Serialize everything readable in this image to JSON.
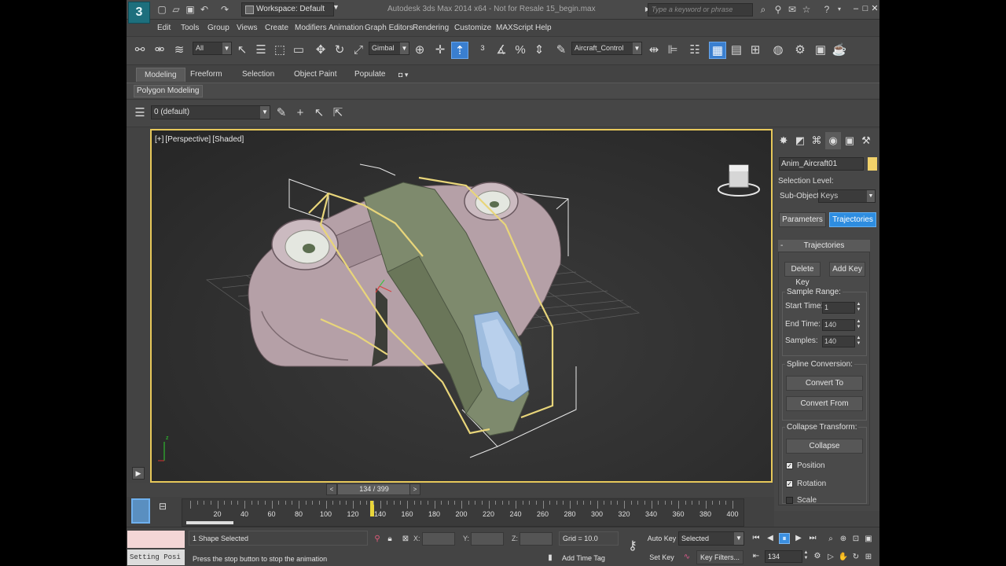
{
  "titlebar": {
    "workspace": "Workspace: Default",
    "title": "Autodesk 3ds Max 2014 x64  -  Not for Resale  15_begin.max",
    "search_placeholder": "Type a keyword or phrase"
  },
  "menu": [
    "Edit",
    "Tools",
    "Group",
    "Views",
    "Create",
    "Modifiers",
    "Animation",
    "Graph Editors",
    "Rendering",
    "Customize",
    "MAXScript",
    "Help"
  ],
  "toolbar": {
    "filter": "All",
    "coord_system": "Gimbal",
    "selection_set": "Aircraft_Control"
  },
  "ribbon": {
    "tabs": [
      "Modeling",
      "Freeform",
      "Selection",
      "Object Paint",
      "Populate"
    ],
    "active_tab": "Modeling",
    "sub_label": "Polygon Modeling",
    "layer": "0 (default)"
  },
  "viewport": {
    "labels": [
      "[+]",
      "[Perspective]",
      "[Shaded]"
    ]
  },
  "command_panel": {
    "object_name": "Anim_Aircraft01",
    "object_color": "#f2d26a",
    "selection_level_label": "Selection Level:",
    "sub_object_label": "Sub-Object",
    "sub_object_value": "Keys",
    "parameters_btn": "Parameters",
    "trajectories_btn": "Trajectories",
    "rollout_title": "Trajectories",
    "delete_key": "Delete Key",
    "add_key": "Add Key",
    "sample_range": {
      "title": "Sample Range:",
      "start_label": "Start Time:",
      "start_value": "1",
      "end_label": "End Time:",
      "end_value": "140",
      "samples_label": "Samples:",
      "samples_value": "140"
    },
    "spline_conversion": {
      "title": "Spline Conversion:",
      "convert_to": "Convert To",
      "convert_from": "Convert From"
    },
    "collapse_transform": {
      "title": "Collapse Transform:",
      "collapse": "Collapse",
      "position": "Position",
      "position_checked": true,
      "rotation": "Rotation",
      "rotation_checked": true,
      "scale": "Scale",
      "scale_checked": false
    }
  },
  "timeline": {
    "slider_label": "134 / 399",
    "current_frame": 134,
    "total_frames": 400,
    "ticks": [
      "20",
      "40",
      "60",
      "80",
      "100",
      "120",
      "140",
      "160",
      "180",
      "200",
      "220",
      "240",
      "260",
      "280",
      "300",
      "320",
      "340",
      "360",
      "380",
      "400"
    ]
  },
  "status": {
    "mini_listener": "Setting Posi",
    "selection_status": "1 Shape Selected",
    "prompt": "Press the stop button to stop the animation",
    "x_label": "X:",
    "y_label": "Y:",
    "z_label": "Z:",
    "grid": "Grid = 10.0",
    "add_time_tag": "Add Time Tag",
    "auto_key": "Auto Key",
    "set_key": "Set Key",
    "key_mode": "Selected",
    "key_filters": "Key Filters...",
    "frame_value": "134"
  }
}
